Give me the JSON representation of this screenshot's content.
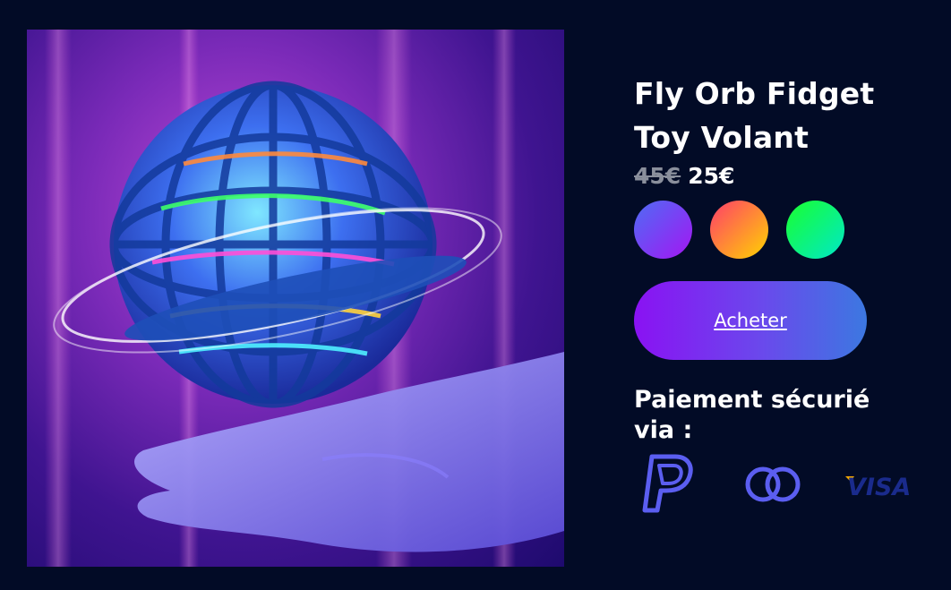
{
  "product": {
    "title": "Fly Orb Fidget Toy Volant",
    "old_price": "45€",
    "price": "25€",
    "image_alt": "Fly Orb product photo"
  },
  "swatches": [
    {
      "name": "blue-purple",
      "from": "#4e6cf5",
      "to": "#a416f2"
    },
    {
      "name": "orange-yellow",
      "from": "#ff3d6b",
      "to": "#ffd400"
    },
    {
      "name": "green-cyan",
      "from": "#1aff2e",
      "to": "#00e8c8"
    }
  ],
  "buy_button": {
    "label": "Acheter"
  },
  "payment": {
    "title": "Paiement sécurié via :",
    "methods": [
      "paypal-icon",
      "mastercard-icon",
      "visa-icon"
    ],
    "visa_text": "VISA"
  },
  "colors": {
    "background": "#020b26",
    "icon_accent": "#5b5ef0",
    "visa_blue": "#1a2b8c",
    "visa_gold": "#f2a900"
  }
}
